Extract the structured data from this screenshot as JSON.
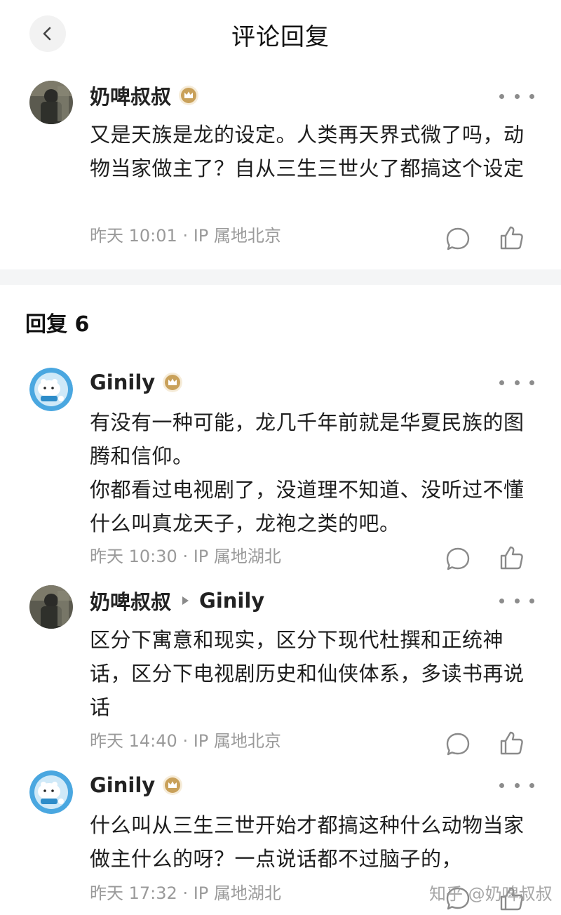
{
  "header": {
    "title": "评论回复"
  },
  "root_comment": {
    "author": "奶啤叔叔",
    "text": "又是天族是龙的设定。人类再天界式微了吗，动物当家做主了？自从三生三世火了都搞这个设定",
    "time": "昨天 10:01",
    "location": "IP 属地北京"
  },
  "replies_heading": "回复 6",
  "replies": [
    {
      "author": "Ginily",
      "text": "有没有一种可能，龙几千年前就是华夏民族的图腾和信仰。\n你都看过电视剧了，没道理不知道、没听过不懂什么叫真龙天子，龙袍之类的吧。",
      "time": "昨天 10:30",
      "location": "IP 属地湖北"
    },
    {
      "author": "奶啤叔叔",
      "reply_to": "Ginily",
      "text": "区分下寓意和现实，区分下现代杜撰和正统神话，区分下电视剧历史和仙侠体系，多读书再说话",
      "time": "昨天 14:40",
      "location": "IP 属地北京"
    },
    {
      "author": "Ginily",
      "text": "什么叫从三生三世开始才都搞这种什么动物当家做主什么的呀？一点说话都不过脑子的，",
      "time": "昨天 17:32",
      "location": "IP 属地湖北"
    }
  ],
  "meta_separator": "·",
  "watermark": "知乎 @奶啤叔叔",
  "colors": {
    "badge_gold": "#c9a15a",
    "text_primary": "#1e1e1e",
    "text_secondary": "#9a9a9a",
    "divider_band": "#f4f5f6",
    "avatar_blue": "#4aa7e0"
  },
  "icons": [
    "back-chevron-icon",
    "crown-badge-icon",
    "more-dots-icon",
    "reply-bubble-icon",
    "like-thumb-icon",
    "reply-arrow-icon"
  ]
}
